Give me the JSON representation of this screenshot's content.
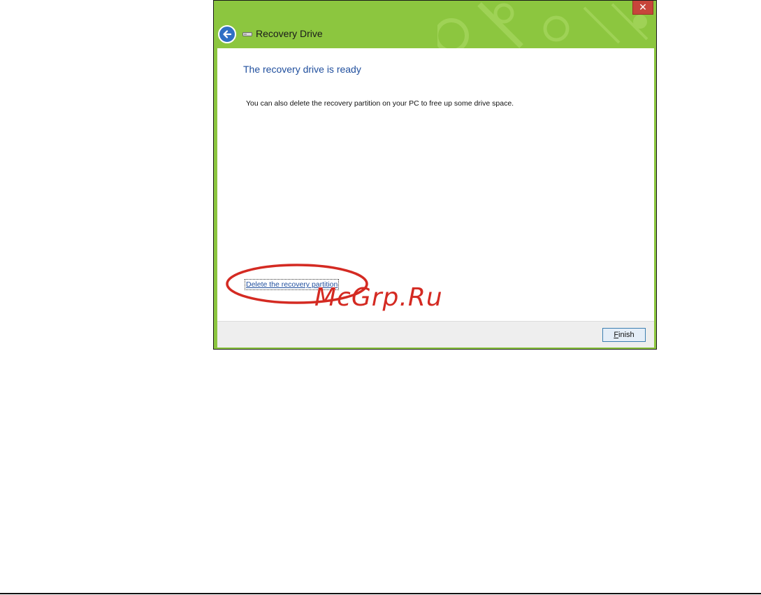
{
  "window": {
    "title": "Recovery Drive",
    "close_glyph": "✕"
  },
  "content": {
    "heading": "The recovery drive is ready",
    "body": "You can also delete the recovery partition on your PC to free up some drive space.",
    "delete_link": "Delete the recovery partition"
  },
  "footer": {
    "finish_mnemonic": "F",
    "finish_rest": "inish"
  },
  "watermark": "McGrp.Ru",
  "colors": {
    "window_frame": "#8cc63f",
    "heading": "#1f4e9d",
    "close_button": "#c7453b",
    "annotation": "#d42a22"
  },
  "icons": [
    "back-arrow-icon",
    "drive-icon",
    "close-icon"
  ]
}
